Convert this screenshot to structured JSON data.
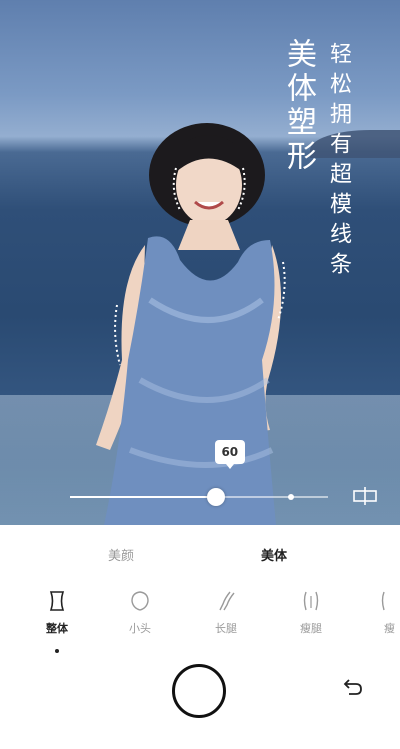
{
  "photo": {
    "headline_main": "美体塑形",
    "headline_sub": "轻松拥有超模线条"
  },
  "slider": {
    "value": 60,
    "value_label": "60",
    "min": 0,
    "max": 100
  },
  "tabs": [
    {
      "label": "美颜",
      "active": false
    },
    {
      "label": "美体",
      "active": true
    }
  ],
  "tools": [
    {
      "label": "整体",
      "icon": "whole-body-icon",
      "active": true
    },
    {
      "label": "小头",
      "icon": "small-head-icon",
      "active": false
    },
    {
      "label": "长腿",
      "icon": "long-legs-icon",
      "active": false
    },
    {
      "label": "瘦腿",
      "icon": "slim-legs-icon",
      "active": false
    },
    {
      "label": "瘦",
      "icon": "slim-icon",
      "active": false
    }
  ],
  "colors": {
    "accent": "#222222",
    "inactive": "#9a9a9a"
  }
}
